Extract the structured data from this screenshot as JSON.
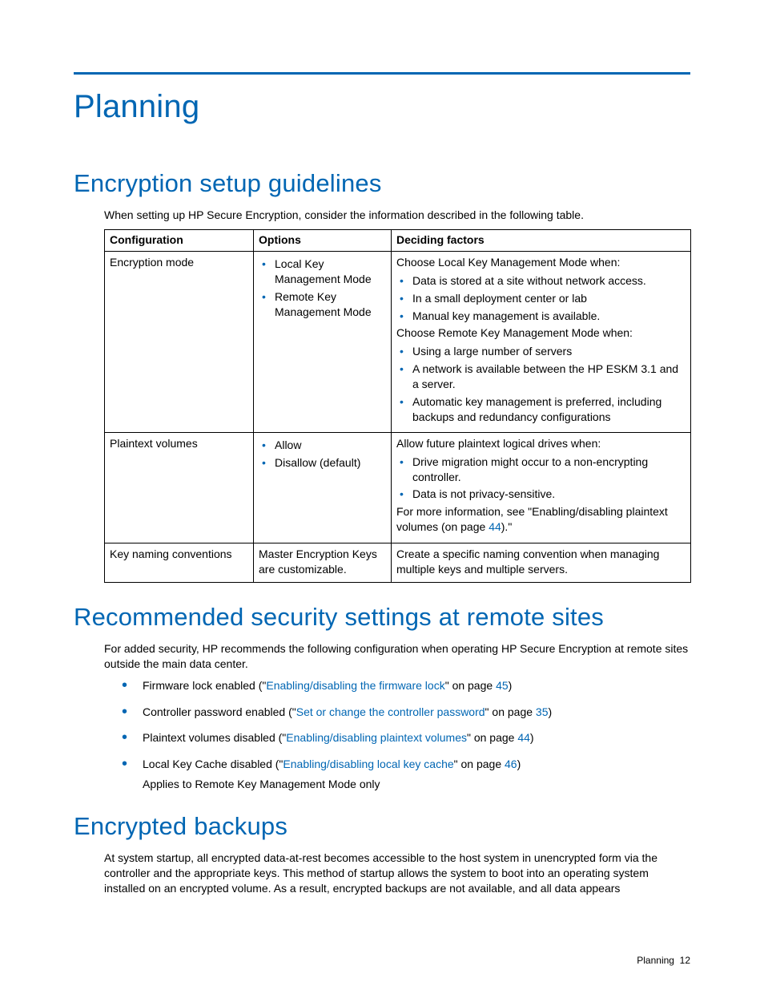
{
  "page_title": "Planning",
  "section1": {
    "heading": "Encryption setup guidelines",
    "intro": "When setting up HP Secure Encryption, consider the information described in the following table.",
    "table": {
      "headers": [
        "Configuration",
        "Options",
        "Deciding factors"
      ],
      "rows": [
        {
          "config": "Encryption mode",
          "options": [
            "Local Key Management Mode",
            "Remote Key Management Mode"
          ],
          "factors": {
            "lead1": "Choose Local Key Management Mode when:",
            "list1": [
              "Data is stored at a site without network access.",
              "In a small deployment center or lab",
              "Manual key management is available."
            ],
            "lead2": "Choose Remote Key Management Mode when:",
            "list2": [
              "Using a large number of servers",
              "A network is available between the HP ESKM 3.1 and a server.",
              "Automatic key management is preferred, including backups and redundancy configurations"
            ]
          }
        },
        {
          "config": "Plaintext volumes",
          "options": [
            "Allow",
            "Disallow (default)"
          ],
          "factors": {
            "lead1": "Allow future plaintext logical drives when:",
            "list1": [
              "Drive migration might occur to a non-encrypting controller.",
              "Data is not privacy-sensitive."
            ],
            "tail_pre": "For more information, see \"Enabling/disabling plaintext volumes (on page ",
            "tail_page": "44",
            "tail_post": ").\""
          }
        },
        {
          "config": "Key naming conventions",
          "options_text": "Master Encryption Keys are customizable.",
          "factors_text": "Create a specific naming convention when managing multiple keys and multiple servers."
        }
      ]
    }
  },
  "section2": {
    "heading": "Recommended security settings at remote sites",
    "intro": "For added security, HP recommends the following configuration when operating HP Secure Encryption at remote sites outside the main data center.",
    "items": [
      {
        "pre": "Firmware lock enabled (\"",
        "link": "Enabling/disabling the firmware lock",
        "mid": "\" on page ",
        "page": "45",
        "post": ")"
      },
      {
        "pre": "Controller password enabled (\"",
        "link": "Set or change the controller password",
        "mid": "\" on page ",
        "page": "35",
        "post": ")"
      },
      {
        "pre": "Plaintext volumes disabled (\"",
        "link": "Enabling/disabling plaintext volumes",
        "mid": "\" on page ",
        "page": "44",
        "post": ")"
      },
      {
        "pre": "Local Key Cache disabled (\"",
        "link": "Enabling/disabling local key cache",
        "mid": "\" on page ",
        "page": "46",
        "post": ")",
        "note": "Applies to Remote Key Management Mode only"
      }
    ]
  },
  "section3": {
    "heading": "Encrypted backups",
    "para": "At system startup, all encrypted data-at-rest becomes accessible to the host system in unencrypted form via the controller and the appropriate keys. This method of startup allows the system to boot into an operating system installed on an encrypted volume. As a result, encrypted backups are not available, and all data appears"
  },
  "footer": {
    "label": "Planning",
    "page": "12"
  }
}
